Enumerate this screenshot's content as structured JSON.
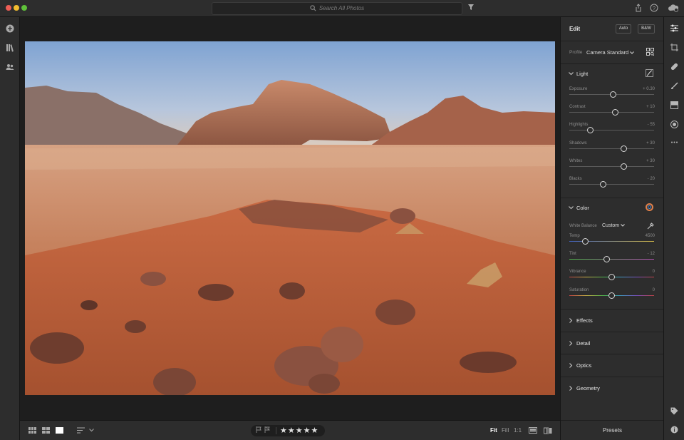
{
  "window": {
    "traffic_lights": [
      "close",
      "minimize",
      "zoom"
    ]
  },
  "topbar": {
    "search_placeholder": "Search All Photos",
    "icons": [
      "search-icon",
      "filter-icon",
      "share-icon",
      "help-icon",
      "cloud-sync-icon"
    ]
  },
  "leftrail": {
    "icons": [
      "add-photos-icon",
      "library-icon",
      "people-icon"
    ]
  },
  "panel": {
    "title": "Edit",
    "auto_label": "Auto",
    "bw_label": "B&W",
    "profile_label": "Profile",
    "profile_value": "Camera Standard",
    "light": {
      "title": "Light",
      "sliders": [
        {
          "label": "Exposure",
          "value": "+ 0.30",
          "position": 0.52
        },
        {
          "label": "Contrast",
          "value": "+ 10",
          "position": 0.54
        },
        {
          "label": "Highlights",
          "value": "- 55",
          "position": 0.25
        },
        {
          "label": "Shadows",
          "value": "+ 30",
          "position": 0.64
        },
        {
          "label": "Whites",
          "value": "+ 30",
          "position": 0.64
        },
        {
          "label": "Blacks",
          "value": "- 20",
          "position": 0.4
        }
      ]
    },
    "color": {
      "title": "Color",
      "wb_label": "White Balance",
      "wb_value": "Custom",
      "sliders": [
        {
          "label": "Temp",
          "value": "4500",
          "position": 0.19,
          "kind": "temp"
        },
        {
          "label": "Tint",
          "value": "- 12",
          "position": 0.44,
          "kind": "tint"
        },
        {
          "label": "Vibrance",
          "value": "0",
          "position": 0.5,
          "kind": "vib"
        },
        {
          "label": "Saturation",
          "value": "0",
          "position": 0.5,
          "kind": "sat"
        }
      ]
    },
    "collapsed_sections": [
      "Effects",
      "Detail",
      "Optics",
      "Geometry"
    ],
    "presets_label": "Presets"
  },
  "rightrail": {
    "icons": [
      "edit-sliders-icon",
      "crop-icon",
      "healing-icon",
      "brush-icon",
      "linear-gradient-icon",
      "radial-gradient-icon",
      "more-icon",
      "tag-icon",
      "info-icon"
    ]
  },
  "bottombar": {
    "view_icons": [
      "square-grid-icon",
      "photo-grid-icon",
      "detail-view-icon",
      "sort-icon"
    ],
    "flags": [
      "pick-flag-icon",
      "reject-flag-icon"
    ],
    "stars": "★★★★★",
    "zoom_fit": "Fit",
    "zoom_fill": "Fill",
    "zoom_1to1": "1:1"
  }
}
